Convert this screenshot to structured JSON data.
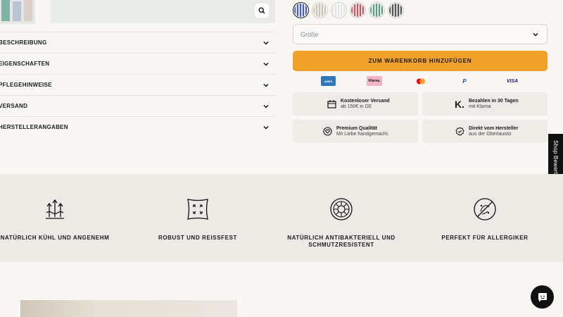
{
  "accordion": {
    "items": [
      {
        "label": "BESCHREIBUNG"
      },
      {
        "label": "EIGENSCHAFTEN"
      },
      {
        "label": "PFLEGEHINWEISE"
      },
      {
        "label": "VERSAND"
      },
      {
        "label": "HERSTELLERANGABEN"
      }
    ]
  },
  "swatches": [
    {
      "color": "#4a5fa8",
      "pattern": "blue-stripe",
      "selected": true
    },
    {
      "color": "#d9d4cc",
      "pattern": "beige-stripe"
    },
    {
      "color": "#eeeeee",
      "pattern": "white-stripe"
    },
    {
      "color": "#c45763",
      "pattern": "red-stripe"
    },
    {
      "color": "#5f9a7f",
      "pattern": "green-stripe"
    },
    {
      "color": "#555555",
      "pattern": "grey-stripe"
    }
  ],
  "size_select": {
    "placeholder": "Größe"
  },
  "cart_button": {
    "label": "ZUM WARENKORB HINZUFÜGEN"
  },
  "payments": [
    {
      "name": "amex-logo",
      "text": "AMEX"
    },
    {
      "name": "klarna-logo",
      "text": "Klarna."
    },
    {
      "name": "mastercard-logo",
      "text": ""
    },
    {
      "name": "paypal-logo",
      "text": "P"
    },
    {
      "name": "visa-logo",
      "text": "VISA"
    }
  ],
  "features": [
    {
      "title": "Kostenloser Versand",
      "sub": "ab 150€ in DE",
      "icon": "shipping-icon"
    },
    {
      "title": "Bezahlen in 30 Tagen",
      "sub": "mit Klarna",
      "icon": "klarna-k-icon"
    },
    {
      "title": "Premium Qualität",
      "sub": "Mit Liebe handgemacht.",
      "icon": "heart-hand-icon"
    },
    {
      "title": "Direkt vom Hersteller",
      "sub": "aus der Oberlausitz",
      "icon": "verified-badge-icon"
    }
  ],
  "side_tab": {
    "label": "Shop Bewertungen"
  },
  "benefits": [
    {
      "label": "NATÜRLICH KÜHL UND ANGENEHM",
      "icon": "cooling-arrows-icon"
    },
    {
      "label": "ROBUST UND REISSFEST",
      "icon": "expand-square-icon"
    },
    {
      "label": "NATÜRLICH ANTIBAKTERIELL UND SCHMUTZRESISTENT",
      "icon": "antibacterial-icon"
    },
    {
      "label": "PERFEKT FÜR ALLERGIKER",
      "icon": "no-allergen-icon"
    }
  ],
  "colors": {
    "accent": "#f0a12a",
    "band": "#ede9e4",
    "background": "#f8f7f4"
  }
}
